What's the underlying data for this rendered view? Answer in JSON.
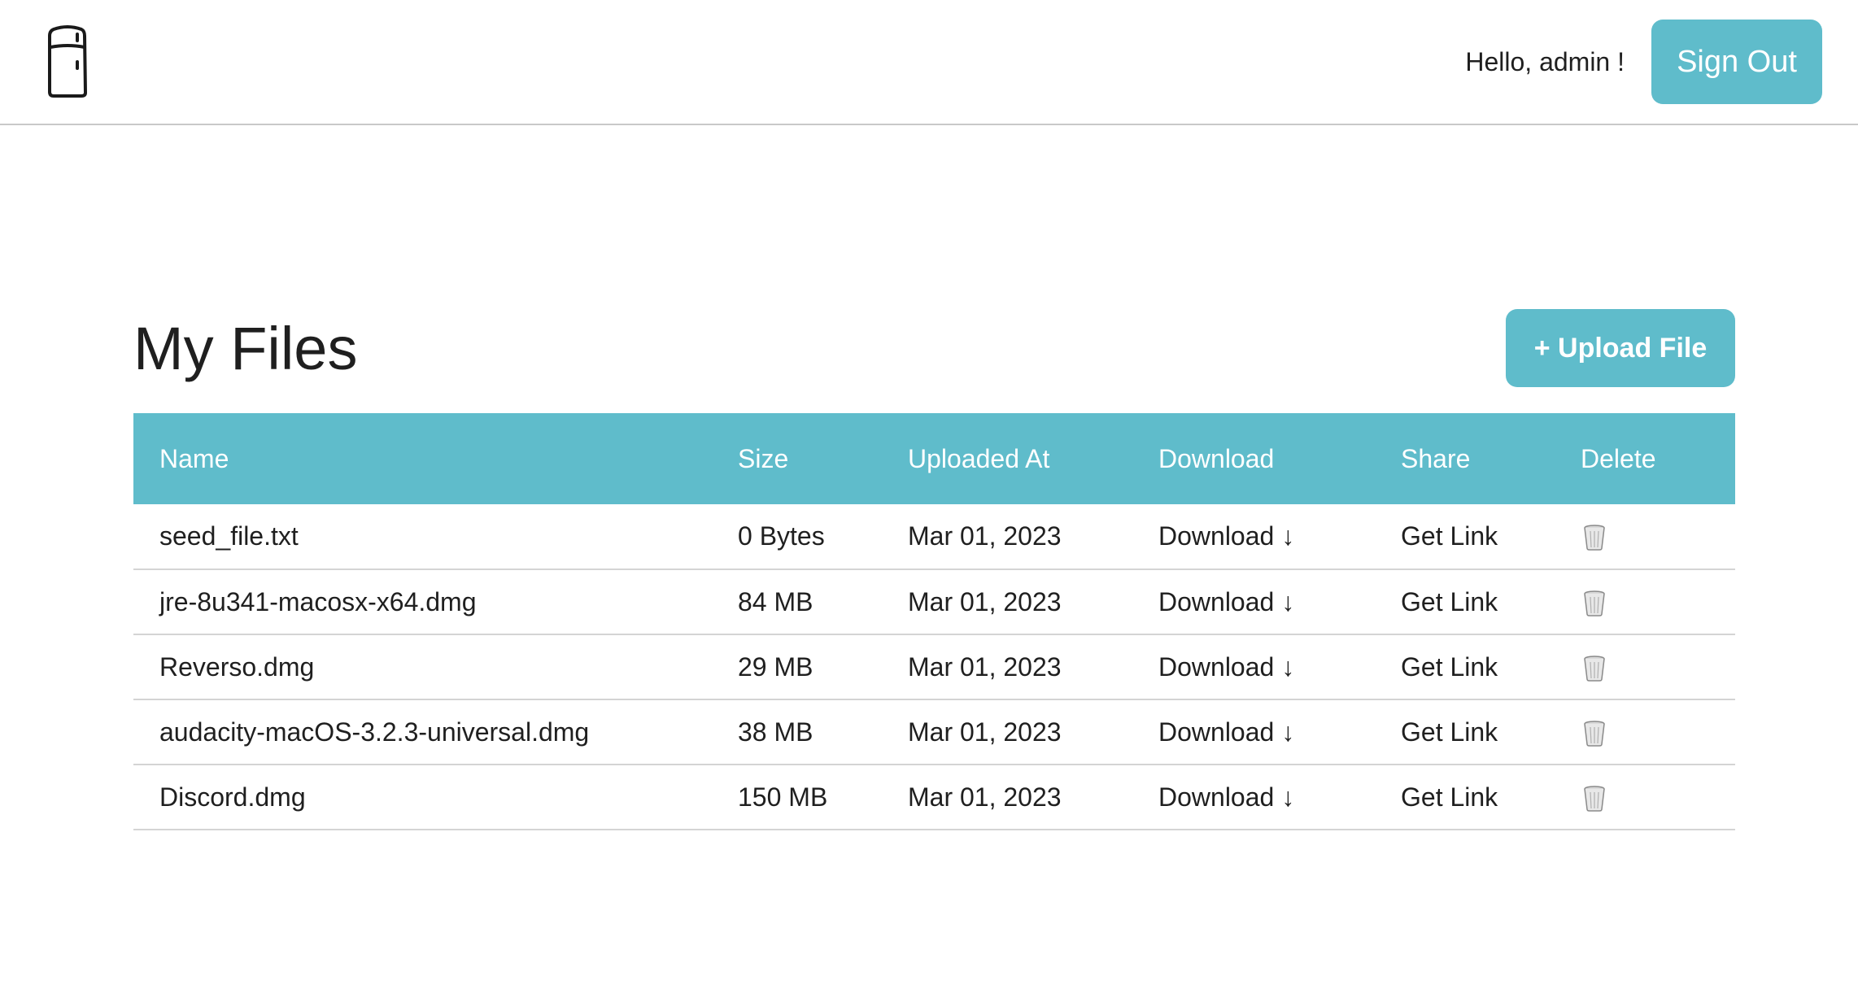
{
  "header": {
    "logo_icon": "refrigerator-icon",
    "greeting": "Hello, admin !",
    "sign_out_label": "Sign Out"
  },
  "main": {
    "title": "My Files",
    "upload_label": "+ Upload File"
  },
  "table": {
    "columns": [
      "Name",
      "Size",
      "Uploaded At",
      "Download",
      "Share",
      "Delete"
    ],
    "rows": [
      {
        "name": "seed_file.txt",
        "size": "0 Bytes",
        "uploaded_at": "Mar 01, 2023",
        "download": "Download ↓",
        "share": "Get Link",
        "delete_icon": "trash-icon"
      },
      {
        "name": "jre-8u341-macosx-x64.dmg",
        "size": "84 MB",
        "uploaded_at": "Mar 01, 2023",
        "download": "Download ↓",
        "share": "Get Link",
        "delete_icon": "trash-icon"
      },
      {
        "name": "Reverso.dmg",
        "size": "29 MB",
        "uploaded_at": "Mar 01, 2023",
        "download": "Download ↓",
        "share": "Get Link",
        "delete_icon": "trash-icon"
      },
      {
        "name": "audacity-macOS-3.2.3-universal.dmg",
        "size": "38 MB",
        "uploaded_at": "Mar 01, 2023",
        "download": "Download ↓",
        "share": "Get Link",
        "delete_icon": "trash-icon"
      },
      {
        "name": "Discord.dmg",
        "size": "150 MB",
        "uploaded_at": "Mar 01, 2023",
        "download": "Download ↓",
        "share": "Get Link",
        "delete_icon": "trash-icon"
      }
    ]
  },
  "colors": {
    "accent": "#5fbccb",
    "text": "#1f1f1f",
    "divider": "#d4d4d4"
  }
}
